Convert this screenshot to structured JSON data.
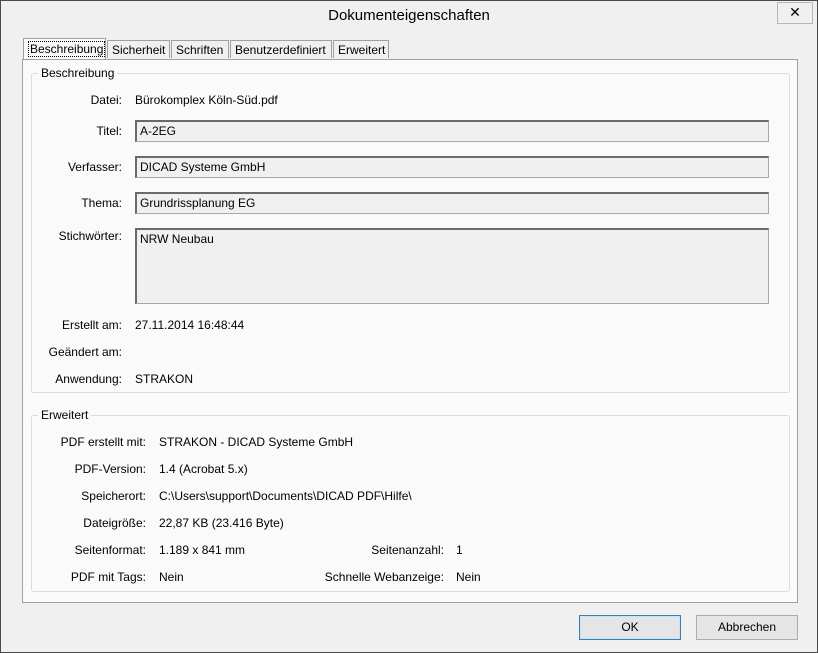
{
  "window": {
    "title": "Dokumenteigenschaften",
    "close_glyph": "✕"
  },
  "tabs": [
    "Beschreibung",
    "Sicherheit",
    "Schriften",
    "Benutzerdefiniert",
    "Erweitert"
  ],
  "beschreibung": {
    "group_title": "Beschreibung",
    "datei_label": "Datei:",
    "datei_value": "Bürokomplex Köln-Süd.pdf",
    "titel_label": "Titel:",
    "titel_value": "A-2EG",
    "verfasser_label": "Verfasser:",
    "verfasser_value": "DICAD Systeme GmbH",
    "thema_label": "Thema:",
    "thema_value": "Grundrissplanung EG",
    "stichwoerter_label": "Stichwörter:",
    "stichwoerter_value": "NRW Neubau",
    "erstellt_label": "Erstellt am:",
    "erstellt_value": "27.11.2014 16:48:44",
    "geaendert_label": "Geändert am:",
    "geaendert_value": "",
    "anwendung_label": "Anwendung:",
    "anwendung_value": "STRAKON"
  },
  "erweitert": {
    "group_title": "Erweitert",
    "pdf_erstellt_label": "PDF erstellt mit:",
    "pdf_erstellt_value": "STRAKON - DICAD Systeme GmbH",
    "pdf_version_label": "PDF-Version:",
    "pdf_version_value": "1.4 (Acrobat 5.x)",
    "speicherort_label": "Speicherort:",
    "speicherort_value": "C:\\Users\\support\\Documents\\DICAD PDF\\Hilfe\\",
    "dateigroesse_label": "Dateigröße:",
    "dateigroesse_value": "22,87 KB (23.416 Byte)",
    "seitenformat_label": "Seitenformat:",
    "seitenformat_value": "1.189 x 841 mm",
    "seitenanzahl_label": "Seitenanzahl:",
    "seitenanzahl_value": "1",
    "tags_label": "PDF mit Tags:",
    "tags_value": "Nein",
    "webanzeige_label": "Schnelle Webanzeige:",
    "webanzeige_value": "Nein"
  },
  "buttons": {
    "ok": "OK",
    "abbrechen": "Abbrechen"
  }
}
